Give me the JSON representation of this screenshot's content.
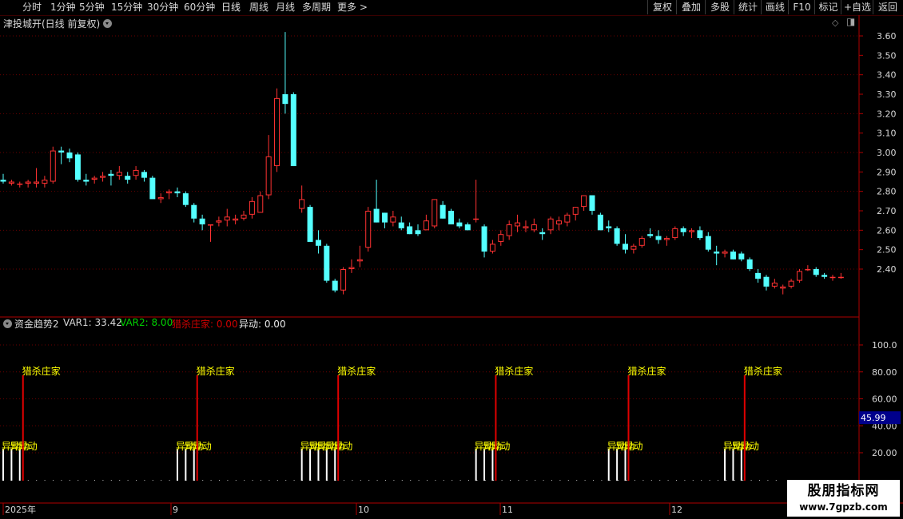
{
  "toolbar": {
    "periods": [
      "分时",
      "1分钟",
      "5分钟",
      "15分钟",
      "30分钟",
      "60分钟",
      "日线",
      "周线",
      "月线",
      "多周期",
      "更多 >"
    ],
    "buttons": [
      "复权",
      "叠加",
      "多股",
      "统计",
      "画线",
      "F10",
      "标记",
      "+自选",
      "返回"
    ]
  },
  "main_chart": {
    "title": "津投城开(日线 前复权)",
    "price_axis_labels": [
      "3.60",
      "3.50",
      "3.40",
      "3.30",
      "3.20",
      "3.10",
      "3.00",
      "2.90",
      "2.80",
      "2.70",
      "2.60",
      "2.50",
      "2.40"
    ]
  },
  "indicator": {
    "name": "资金趋势2",
    "var1_label": "VAR1: 33.42",
    "var2_label": "VAR2: 8.00",
    "lieshazhuangjia_label": "猎杀庄家: 0.00",
    "yidong_label": "异动: 0.00",
    "axis_labels": [
      "100.0",
      "80.00",
      "60.00",
      "40.00",
      "20.00"
    ],
    "current_value": "45.99",
    "signal_text": "猎杀庄家",
    "yidong_text": "异动"
  },
  "time_axis": {
    "labels": [
      "2025年",
      "9",
      "10",
      "11",
      "12"
    ]
  },
  "watermark": {
    "title": "股朋指标网",
    "url": "www.7gpzb.com"
  },
  "chart_data": {
    "type": "candlestick",
    "title": "津投城开(日线 前复权)",
    "ylim": [
      2.3,
      3.65
    ],
    "candles": [
      [
        2.86,
        2.89,
        2.84,
        2.85
      ],
      [
        2.84,
        2.86,
        2.83,
        2.85
      ],
      [
        2.84,
        2.85,
        2.82,
        2.84
      ],
      [
        2.84,
        2.86,
        2.82,
        2.85
      ],
      [
        2.84,
        2.92,
        2.82,
        2.85
      ],
      [
        2.84,
        2.88,
        2.82,
        2.86
      ],
      [
        2.85,
        3.03,
        2.84,
        3.01
      ],
      [
        3.01,
        3.03,
        2.94,
        3.0
      ],
      [
        3.0,
        3.02,
        2.95,
        2.97
      ],
      [
        2.99,
        3.0,
        2.85,
        2.86
      ],
      [
        2.86,
        2.89,
        2.83,
        2.85
      ],
      [
        2.86,
        2.88,
        2.84,
        2.87
      ],
      [
        2.87,
        2.9,
        2.85,
        2.88
      ],
      [
        2.89,
        2.91,
        2.83,
        2.88
      ],
      [
        2.88,
        2.93,
        2.86,
        2.9
      ],
      [
        2.88,
        2.9,
        2.84,
        2.86
      ],
      [
        2.88,
        2.93,
        2.86,
        2.91
      ],
      [
        2.9,
        2.91,
        2.85,
        2.87
      ],
      [
        2.87,
        2.88,
        2.77,
        2.76
      ],
      [
        2.76,
        2.79,
        2.74,
        2.77
      ],
      [
        2.79,
        2.81,
        2.76,
        2.8
      ],
      [
        2.8,
        2.82,
        2.77,
        2.79
      ],
      [
        2.79,
        2.8,
        2.72,
        2.73
      ],
      [
        2.73,
        2.74,
        2.64,
        2.66
      ],
      [
        2.66,
        2.68,
        2.6,
        2.63
      ],
      [
        2.63,
        2.63,
        2.54,
        2.63
      ],
      [
        2.64,
        2.67,
        2.62,
        2.65
      ],
      [
        2.65,
        2.71,
        2.62,
        2.67
      ],
      [
        2.65,
        2.68,
        2.63,
        2.66
      ],
      [
        2.66,
        2.7,
        2.65,
        2.68
      ],
      [
        2.68,
        2.77,
        2.66,
        2.75
      ],
      [
        2.69,
        2.8,
        2.69,
        2.78
      ],
      [
        2.78,
        3.09,
        2.76,
        2.98
      ],
      [
        2.93,
        3.33,
        2.9,
        3.28
      ],
      [
        3.3,
        3.62,
        3.2,
        3.25
      ],
      [
        3.3,
        3.31,
        2.93,
        2.93
      ],
      [
        2.71,
        2.83,
        2.69,
        2.76
      ],
      [
        2.72,
        2.73,
        2.55,
        2.54
      ],
      [
        2.55,
        2.6,
        2.48,
        2.52
      ],
      [
        2.52,
        2.53,
        2.33,
        2.34
      ],
      [
        2.34,
        2.35,
        2.28,
        2.29
      ],
      [
        2.29,
        2.41,
        2.27,
        2.4
      ],
      [
        2.4,
        2.45,
        2.38,
        2.41
      ],
      [
        2.44,
        2.52,
        2.41,
        2.45
      ],
      [
        2.51,
        2.72,
        2.49,
        2.7
      ],
      [
        2.71,
        2.86,
        2.64,
        2.64
      ],
      [
        2.69,
        2.69,
        2.61,
        2.64
      ],
      [
        2.64,
        2.7,
        2.62,
        2.67
      ],
      [
        2.64,
        2.67,
        2.6,
        2.61
      ],
      [
        2.62,
        2.64,
        2.58,
        2.58
      ],
      [
        2.6,
        2.63,
        2.57,
        2.58
      ],
      [
        2.6,
        2.68,
        2.6,
        2.65
      ],
      [
        2.62,
        2.76,
        2.61,
        2.76
      ],
      [
        2.73,
        2.75,
        2.66,
        2.66
      ],
      [
        2.7,
        2.71,
        2.63,
        2.63
      ],
      [
        2.64,
        2.66,
        2.61,
        2.62
      ],
      [
        2.63,
        2.64,
        2.6,
        2.6
      ],
      [
        2.66,
        2.86,
        2.64,
        2.66
      ],
      [
        2.62,
        2.63,
        2.46,
        2.49
      ],
      [
        2.49,
        2.55,
        2.48,
        2.53
      ],
      [
        2.54,
        2.6,
        2.52,
        2.58
      ],
      [
        2.57,
        2.65,
        2.55,
        2.63
      ],
      [
        2.62,
        2.68,
        2.59,
        2.64
      ],
      [
        2.61,
        2.65,
        2.59,
        2.62
      ],
      [
        2.6,
        2.66,
        2.59,
        2.63
      ],
      [
        2.59,
        2.61,
        2.55,
        2.58
      ],
      [
        2.6,
        2.67,
        2.58,
        2.66
      ],
      [
        2.63,
        2.67,
        2.6,
        2.65
      ],
      [
        2.64,
        2.69,
        2.62,
        2.68
      ],
      [
        2.68,
        2.72,
        2.65,
        2.72
      ],
      [
        2.72,
        2.78,
        2.7,
        2.78
      ],
      [
        2.78,
        2.78,
        2.68,
        2.7
      ],
      [
        2.68,
        2.69,
        2.6,
        2.6
      ],
      [
        2.62,
        2.65,
        2.59,
        2.61
      ],
      [
        2.61,
        2.62,
        2.52,
        2.53
      ],
      [
        2.53,
        2.58,
        2.48,
        2.5
      ],
      [
        2.5,
        2.53,
        2.48,
        2.52
      ],
      [
        2.52,
        2.57,
        2.51,
        2.56
      ],
      [
        2.58,
        2.61,
        2.56,
        2.57
      ],
      [
        2.57,
        2.6,
        2.53,
        2.55
      ],
      [
        2.55,
        2.57,
        2.52,
        2.56
      ],
      [
        2.56,
        2.62,
        2.55,
        2.61
      ],
      [
        2.61,
        2.62,
        2.57,
        2.59
      ],
      [
        2.59,
        2.61,
        2.56,
        2.6
      ],
      [
        2.6,
        2.62,
        2.55,
        2.56
      ],
      [
        2.57,
        2.59,
        2.49,
        2.5
      ],
      [
        2.49,
        2.52,
        2.42,
        2.48
      ],
      [
        2.48,
        2.5,
        2.46,
        2.49
      ],
      [
        2.49,
        2.5,
        2.45,
        2.45
      ],
      [
        2.48,
        2.49,
        2.44,
        2.45
      ],
      [
        2.45,
        2.46,
        2.39,
        2.4
      ],
      [
        2.38,
        2.4,
        2.33,
        2.35
      ],
      [
        2.36,
        2.37,
        2.29,
        2.31
      ],
      [
        2.31,
        2.35,
        2.3,
        2.33
      ],
      [
        2.3,
        2.32,
        2.27,
        2.31
      ],
      [
        2.31,
        2.35,
        2.3,
        2.34
      ],
      [
        2.34,
        2.4,
        2.33,
        2.39
      ],
      [
        2.4,
        2.42,
        2.39,
        2.4
      ],
      [
        2.4,
        2.41,
        2.36,
        2.37
      ],
      [
        2.37,
        2.38,
        2.35,
        2.36
      ],
      [
        2.36,
        2.37,
        2.34,
        2.36
      ],
      [
        2.36,
        2.38,
        2.35,
        2.36
      ]
    ],
    "indicator_signal_days": [
      2,
      23,
      40,
      59,
      75,
      89
    ],
    "indicator_yidong_days": [
      [
        0,
        1,
        2
      ],
      [
        21,
        22,
        23
      ],
      [
        36,
        37,
        38,
        39,
        40
      ],
      [
        57,
        58,
        59
      ],
      [
        73,
        74,
        75
      ],
      [
        87,
        88,
        89
      ]
    ]
  }
}
